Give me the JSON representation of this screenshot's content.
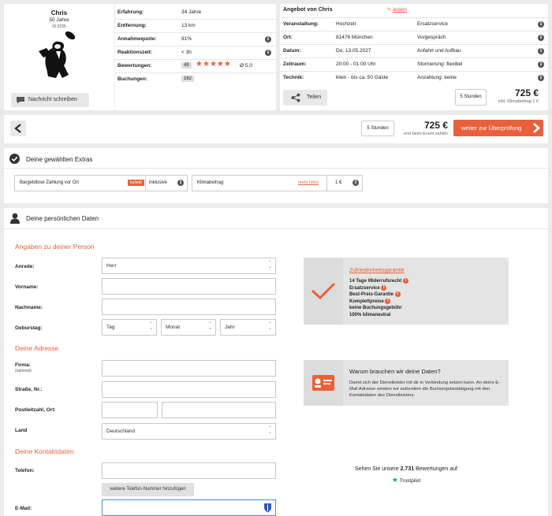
{
  "provider": {
    "name": "Chris",
    "age": "50 Jahre",
    "id": "ID:2235",
    "message_button": "Nachricht schreiben"
  },
  "stats": [
    {
      "label": "Erfahrung:",
      "value": "34 Jahre"
    },
    {
      "label": "Entfernung:",
      "value": "13 km"
    },
    {
      "label": "Annahmequote:",
      "value": "91%"
    },
    {
      "label": "Reaktionszeit:",
      "value": "< 3h"
    },
    {
      "label": "Bewertungen:",
      "value": "49",
      "rating": "Ø 5.0",
      "stars": 5
    },
    {
      "label": "Buchungen:",
      "value": "162"
    }
  ],
  "offer": {
    "title": "Angebot von Chris",
    "edit_link": "ändern",
    "rows": [
      {
        "label": "Veranstaltung:",
        "value": "Hochzeit",
        "extra": "Ersatzservice"
      },
      {
        "label": "Ort:",
        "value": "81476 München",
        "extra": "Vorgespräch"
      },
      {
        "label": "Datum:",
        "value": "Do, 13.05.2027",
        "extra": "Anfahrt und Aufbau"
      },
      {
        "label": "Zeitraum:",
        "value": "20:00 - 01:00 Uhr",
        "extra": "Stornierung: flexibel"
      },
      {
        "label": "Technik:",
        "value": "klein - bis ca. 50 Gäste",
        "extra": "Anzahlung: keine"
      }
    ],
    "share_button": "Teilen",
    "hours": "5 Stunden",
    "price": "725 €",
    "price_note": "inkl. Klimabeitrag 1 €"
  },
  "nav_bar": {
    "hours": "5 Stunden",
    "price": "725 €",
    "price_note": "erst beim Event zahlen",
    "cta": "weiter zur Überprüfung"
  },
  "extras": {
    "title": "Deine gewählten Extras",
    "items": [
      {
        "name": "Bargeldlose Zahlung vor Ort",
        "tag": "beliebt",
        "status": "inklusive"
      },
      {
        "name": "Klimabeitrag",
        "link": "mehr Infos",
        "price": "1 €"
      }
    ]
  },
  "personal": {
    "title": "Deine persönlichen Daten",
    "section_person": "Angaben zu deiner Person",
    "anrede_label": "Anrede:",
    "anrede_value": "Herr",
    "vorname_label": "Vorname:",
    "nachname_label": "Nachname:",
    "geburtstag_label": "Geburstag:",
    "tag": "Tag",
    "monat": "Monat",
    "jahr": "Jahr",
    "section_address": "Deine Adresse",
    "firma_label": "Firma:",
    "firma_optional": "(optional)",
    "strasse_label": "Straße, Nr.:",
    "plz_label": "Postleitzahl, Ort:",
    "land_label": "Land",
    "land_value": "Deutschland",
    "section_contact": "Deine Kontaktdaten",
    "telefon_label": "Telefon:",
    "add_phone": "weitere Telefon-Nummer hinzufügen",
    "email_label": "E-Mail:"
  },
  "guarantee": {
    "title": "Zufriedenheitsgarantie",
    "items": [
      "14 Tage Widerrufsrecht",
      "Ersatzservice",
      "Best-Preis-Garantie",
      "Komplettpreise",
      "keine Buchungsgebühr",
      "100% klimaneutral"
    ]
  },
  "why_data": {
    "title": "Warum brauchen wir deine Daten?",
    "text": "Damit sich der Dienstleister mit dir in Verbindung setzen kann. An deine E-Mail Adresse senden wir außerdem die Buchungsbestätigung mit den Kontaktdaten des Dienstleisters."
  },
  "trust": {
    "text_before": "Sehen Sie unsere",
    "count": "2.731",
    "text_after": "Bewertungen auf",
    "brand": "Trustpilot"
  },
  "colors": {
    "accent": "#e8613c",
    "star": "#e8613c",
    "trust_green": "#00b67a"
  }
}
